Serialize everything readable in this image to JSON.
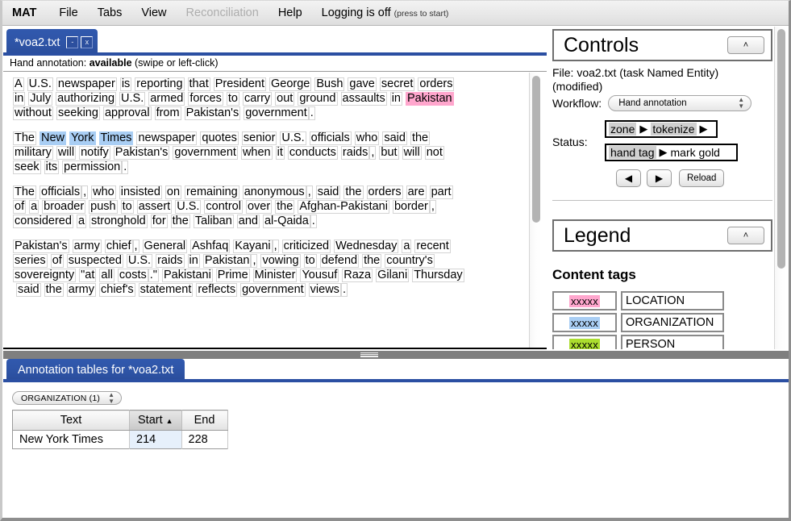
{
  "menu": {
    "brand": "MAT",
    "items": [
      {
        "label": "File",
        "disabled": false
      },
      {
        "label": "Tabs",
        "disabled": false
      },
      {
        "label": "View",
        "disabled": false
      },
      {
        "label": "Reconciliation",
        "disabled": true
      },
      {
        "label": "Help",
        "disabled": false
      }
    ],
    "logging_label": "Logging is off",
    "logging_hint": "(press to start)"
  },
  "document_tab": {
    "label": "*voa2.txt",
    "minimize_label": "-",
    "close_label": "x"
  },
  "hand_annotation": {
    "prefix": "Hand annotation:",
    "state": "available",
    "hint": "(swipe or left-click)"
  },
  "text": {
    "paragraphs": [
      [
        {
          "t": "A",
          "c": "plain"
        },
        {
          "t": "U.S.",
          "c": "plain"
        },
        {
          "t": "newspaper",
          "c": "plain"
        },
        {
          "t": "is",
          "c": "plain"
        },
        {
          "t": "reporting",
          "c": "plain"
        },
        {
          "t": "that",
          "c": "plain"
        },
        {
          "t": "President",
          "c": "plain"
        },
        {
          "t": "George",
          "c": "plain"
        },
        {
          "t": "Bush",
          "c": "plain"
        },
        {
          "t": "gave",
          "c": "plain"
        },
        {
          "t": "secret",
          "c": "plain"
        },
        {
          "t": "orders",
          "c": "plain"
        },
        {
          "t": "in",
          "c": "plain"
        },
        {
          "t": "July",
          "c": "plain"
        },
        {
          "t": "authorizing",
          "c": "plain"
        },
        {
          "t": "U.S.",
          "c": "plain"
        },
        {
          "t": "armed",
          "c": "plain"
        },
        {
          "t": "forces",
          "c": "plain"
        },
        {
          "t": "to",
          "c": "plain"
        },
        {
          "t": "carry",
          "c": "plain"
        },
        {
          "t": "out",
          "c": "plain"
        },
        {
          "t": "ground",
          "c": "plain"
        },
        {
          "t": "assaults",
          "c": "plain"
        },
        {
          "t": "in",
          "c": "plain"
        },
        {
          "t": "Pakistan",
          "c": "loc"
        },
        {
          "t": "without",
          "c": "plain"
        },
        {
          "t": "seeking",
          "c": "plain"
        },
        {
          "t": "approval",
          "c": "plain"
        },
        {
          "t": "from",
          "c": "plain"
        },
        {
          "t": "Pakistan's",
          "c": "plain"
        },
        {
          "t": "government",
          "c": "plain"
        },
        {
          "t": ".",
          "c": "plain",
          "nosp": true
        }
      ],
      [
        {
          "t": "The",
          "c": "plain"
        },
        {
          "t": "New",
          "c": "org"
        },
        {
          "t": "York",
          "c": "org"
        },
        {
          "t": "Times",
          "c": "org"
        },
        {
          "t": "newspaper",
          "c": "plain"
        },
        {
          "t": "quotes",
          "c": "plain"
        },
        {
          "t": "senior",
          "c": "plain"
        },
        {
          "t": "U.S.",
          "c": "plain"
        },
        {
          "t": "officials",
          "c": "plain"
        },
        {
          "t": "who",
          "c": "plain"
        },
        {
          "t": "said",
          "c": "plain"
        },
        {
          "t": "the",
          "c": "plain"
        },
        {
          "t": "military",
          "c": "plain"
        },
        {
          "t": "will",
          "c": "plain"
        },
        {
          "t": "notify",
          "c": "plain"
        },
        {
          "t": "Pakistan's",
          "c": "plain"
        },
        {
          "t": "government",
          "c": "plain"
        },
        {
          "t": "when",
          "c": "plain"
        },
        {
          "t": "it",
          "c": "plain"
        },
        {
          "t": "conducts",
          "c": "plain"
        },
        {
          "t": "raids",
          "c": "plain"
        },
        {
          "t": ",",
          "c": "plain",
          "nosp": true
        },
        {
          "t": "but",
          "c": "plain"
        },
        {
          "t": "will",
          "c": "plain"
        },
        {
          "t": "not",
          "c": "plain"
        },
        {
          "t": "seek",
          "c": "plain"
        },
        {
          "t": "its",
          "c": "plain"
        },
        {
          "t": "permission",
          "c": "plain"
        },
        {
          "t": ".",
          "c": "plain",
          "nosp": true
        }
      ],
      [
        {
          "t": "The",
          "c": "plain"
        },
        {
          "t": "officials",
          "c": "plain"
        },
        {
          "t": ",",
          "c": "plain",
          "nosp": true
        },
        {
          "t": "who",
          "c": "plain"
        },
        {
          "t": "insisted",
          "c": "plain"
        },
        {
          "t": "on",
          "c": "plain"
        },
        {
          "t": "remaining",
          "c": "plain"
        },
        {
          "t": "anonymous",
          "c": "plain"
        },
        {
          "t": ",",
          "c": "plain",
          "nosp": true
        },
        {
          "t": "said",
          "c": "plain"
        },
        {
          "t": "the",
          "c": "plain"
        },
        {
          "t": "orders",
          "c": "plain"
        },
        {
          "t": "are",
          "c": "plain"
        },
        {
          "t": "part",
          "c": "plain"
        },
        {
          "t": "of",
          "c": "plain"
        },
        {
          "t": "a",
          "c": "plain"
        },
        {
          "t": "broader",
          "c": "plain"
        },
        {
          "t": "push",
          "c": "plain"
        },
        {
          "t": "to",
          "c": "plain"
        },
        {
          "t": "assert",
          "c": "plain"
        },
        {
          "t": "U.S.",
          "c": "plain"
        },
        {
          "t": "control",
          "c": "plain"
        },
        {
          "t": "over",
          "c": "plain"
        },
        {
          "t": "the",
          "c": "plain"
        },
        {
          "t": "Afghan-Pakistani",
          "c": "plain"
        },
        {
          "t": "border",
          "c": "plain"
        },
        {
          "t": ",",
          "c": "plain",
          "nosp": true
        },
        {
          "t": "considered",
          "c": "plain"
        },
        {
          "t": "a",
          "c": "plain"
        },
        {
          "t": "stronghold",
          "c": "plain"
        },
        {
          "t": "for",
          "c": "plain"
        },
        {
          "t": "the",
          "c": "plain"
        },
        {
          "t": "Taliban",
          "c": "plain"
        },
        {
          "t": "and",
          "c": "plain"
        },
        {
          "t": "al-Qaida",
          "c": "plain"
        },
        {
          "t": ".",
          "c": "plain",
          "nosp": true
        }
      ],
      [
        {
          "t": "Pakistan's",
          "c": "plain"
        },
        {
          "t": "army",
          "c": "plain"
        },
        {
          "t": "chief",
          "c": "plain"
        },
        {
          "t": ",",
          "c": "plain",
          "nosp": true
        },
        {
          "t": "General",
          "c": "plain"
        },
        {
          "t": "Ashfaq",
          "c": "plain"
        },
        {
          "t": "Kayani",
          "c": "plain"
        },
        {
          "t": ",",
          "c": "plain",
          "nosp": true
        },
        {
          "t": "criticized",
          "c": "plain"
        },
        {
          "t": "Wednesday",
          "c": "plain"
        },
        {
          "t": "a",
          "c": "plain"
        },
        {
          "t": "recent",
          "c": "plain"
        },
        {
          "t": "series",
          "c": "plain"
        },
        {
          "t": "of",
          "c": "plain"
        },
        {
          "t": "suspected",
          "c": "plain"
        },
        {
          "t": "U.S.",
          "c": "plain"
        },
        {
          "t": "raids",
          "c": "plain"
        },
        {
          "t": "in",
          "c": "plain"
        },
        {
          "t": "Pakistan",
          "c": "plain"
        },
        {
          "t": ",",
          "c": "plain",
          "nosp": true
        },
        {
          "t": "vowing",
          "c": "plain"
        },
        {
          "t": "to",
          "c": "plain"
        },
        {
          "t": "defend",
          "c": "plain"
        },
        {
          "t": "the",
          "c": "plain"
        },
        {
          "t": "country's",
          "c": "plain"
        },
        {
          "t": "sovereignty",
          "c": "plain"
        },
        {
          "t": "\"at",
          "c": "plain"
        },
        {
          "t": "all",
          "c": "plain"
        },
        {
          "t": "costs",
          "c": "plain"
        },
        {
          "t": ".\"",
          "c": "plain",
          "nosp": true
        },
        {
          "t": "Pakistani",
          "c": "plain"
        },
        {
          "t": "Prime",
          "c": "plain"
        },
        {
          "t": "Minister",
          "c": "plain"
        },
        {
          "t": "Yousuf",
          "c": "plain"
        },
        {
          "t": "Raza",
          "c": "plain"
        },
        {
          "t": "Gilani",
          "c": "plain"
        },
        {
          "t": "Thursday",
          "c": "plain"
        },
        {
          "t": "said",
          "c": "plain"
        },
        {
          "t": "the",
          "c": "plain"
        },
        {
          "t": "army",
          "c": "plain"
        },
        {
          "t": "chief's",
          "c": "plain"
        },
        {
          "t": "statement",
          "c": "plain"
        },
        {
          "t": "reflects",
          "c": "plain"
        },
        {
          "t": "government",
          "c": "plain"
        },
        {
          "t": "views",
          "c": "plain"
        },
        {
          "t": ".",
          "c": "plain",
          "nosp": true
        }
      ]
    ]
  },
  "controls": {
    "title": "Controls",
    "collapse_label": "˄",
    "file_line": "File: voa2.txt (task Named Entity) (modified)",
    "workflow_label": "Workflow:",
    "workflow_value": "Hand annotation",
    "status_label": "Status:",
    "chain_row1": [
      {
        "type": "step",
        "label": "zone"
      },
      {
        "type": "arrow",
        "label": "▶"
      },
      {
        "type": "step",
        "label": "tokenize"
      },
      {
        "type": "arrow",
        "label": "▶"
      }
    ],
    "chain_row2": [
      {
        "type": "step",
        "label": "hand tag"
      },
      {
        "type": "arrow",
        "label": "▶"
      },
      {
        "type": "step_plain",
        "label": "mark gold"
      }
    ],
    "prev_label": "◀",
    "next_label": "▶",
    "reload_label": "Reload"
  },
  "legend": {
    "title": "Legend",
    "collapse_label": "˄",
    "section_title": "Content tags",
    "swatch_text": "xxxxx",
    "rows": [
      {
        "name": "LOCATION",
        "color": "#ffa6cd",
        "cls": "loc"
      },
      {
        "name": "ORGANIZATION",
        "color": "#a9cef4",
        "cls": "org"
      },
      {
        "name": "PERSON",
        "color": "#abdd2f",
        "cls": "per"
      }
    ]
  },
  "bottom": {
    "tab_label": "Annotation tables for *voa2.txt",
    "tag_select_value": "ORGANIZATION (1)",
    "columns": [
      "Text",
      "Start",
      "End"
    ],
    "sorted_column": "Start",
    "sort_arrow": "▲",
    "rows": [
      {
        "text": "New York Times",
        "start": "214",
        "end": "228"
      }
    ]
  },
  "colors": {
    "tab_blue": "#2e54a6",
    "accent_blue": "#2b4fa2",
    "location": "#ffa6cd",
    "organization": "#a9cef4",
    "person": "#abdd2f",
    "splitter": "#7f7f7f"
  }
}
